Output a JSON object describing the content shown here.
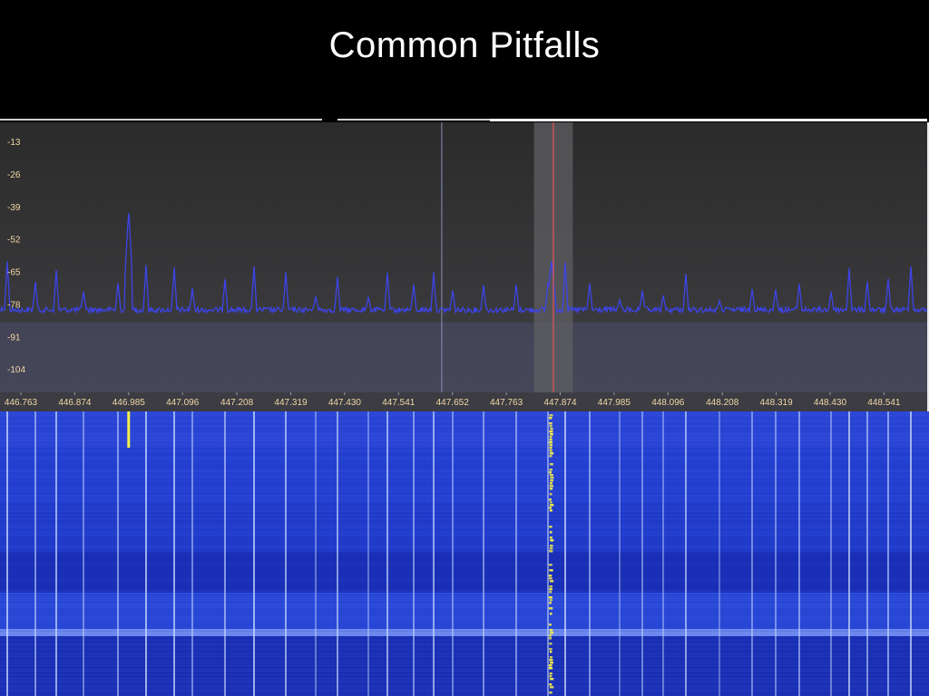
{
  "slide": {
    "title": "Common Pitfalls"
  },
  "spectrum": {
    "db_labels": [
      "-13",
      "-26",
      "-39",
      "-52",
      "-65",
      "-78",
      "-91",
      "-104"
    ],
    "freq_labels": [
      "446.763",
      "446.874",
      "446.985",
      "447.096",
      "447.208",
      "447.319",
      "447.430",
      "447.541",
      "447.652",
      "447.763",
      "447.874",
      "447.985",
      "448.096",
      "448.208",
      "448.319",
      "448.430",
      "448.541"
    ],
    "frequency_range": [
      446.72,
      448.63
    ],
    "db_range": [
      -5,
      -113
    ],
    "noise_floor_db": -80,
    "threshold_db": -85,
    "filter_band": [
      447.82,
      447.9
    ],
    "tuned_frequency": 447.86,
    "marker_frequency": 447.63,
    "peak_frequencies": [
      446.985,
      447.856
    ],
    "colors": {
      "trace": "#3d44e6",
      "filter_band": "#5f5f63",
      "tuned_line": "#e2545a",
      "marker_line": "#8a8fb8",
      "label": "#f2d7a6",
      "waterfall_base": "#1f37c8",
      "waterfall_signal": "#f6f04a"
    }
  }
}
